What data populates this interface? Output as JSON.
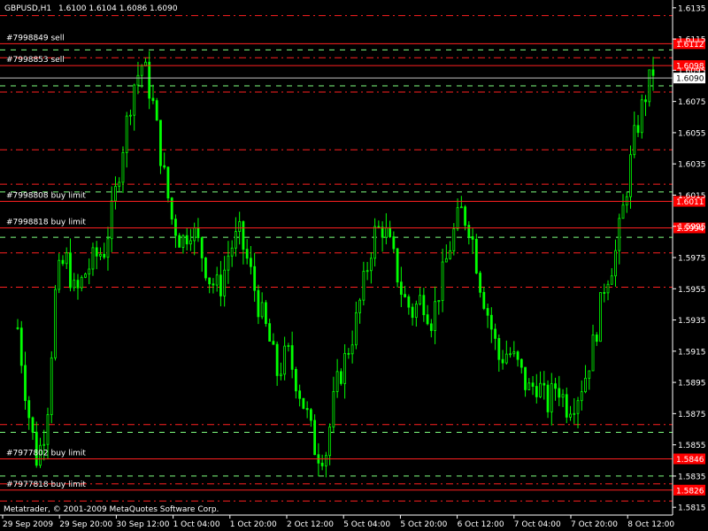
{
  "header": {
    "symbol": "GBPUSD,H1",
    "ohlc": "1.6100 1.6104 1.6086 1.6090"
  },
  "footer": {
    "copyright": "Metatrader, © 2001-2009 MetaQuotes Software Corp."
  },
  "colors": {
    "background": "#000000",
    "candle": "#00ff00",
    "order_line": "#ff2020",
    "level_line": "#ff2020",
    "buy_level_line": "#80ff80",
    "axis": "#ffffff",
    "current_price_tag_bg": "#ffffff",
    "order_tag_bg": "#ff0000"
  },
  "orders": [
    {
      "label": "#7998849 sell",
      "price": 1.6112,
      "tag": "1.6112"
    },
    {
      "label": "#7998853 sell",
      "price": 1.6098,
      "tag": "1.6098"
    },
    {
      "label": "#7998808 buy limit",
      "price": 1.6011,
      "tag": "1.6011"
    },
    {
      "label": "#7998818 buy limit",
      "price": 1.5994,
      "tag": "1.5994"
    },
    {
      "label": "#7977802 buy limit",
      "price": 1.5846,
      "tag": "1.5846"
    },
    {
      "label": "#7977818 buy limit",
      "price": 1.5826,
      "tag": "1.5826"
    }
  ],
  "current_price": {
    "price": 1.609,
    "tag": "1.6090"
  },
  "red_levels": [
    1.613,
    1.6103,
    1.6081,
    1.6044,
    1.6022,
    1.5978,
    1.5956,
    1.5868,
    1.583,
    1.5819
  ],
  "green_levels": [
    1.6108,
    1.6085,
    1.6017,
    1.5988,
    1.5863,
    1.5835
  ],
  "chart_data": {
    "type": "candlestick",
    "ylim": [
      1.581,
      1.614
    ],
    "y_ticks": [
      "1.6135",
      "1.6115",
      "1.6095",
      "1.6075",
      "1.6055",
      "1.6035",
      "1.6015",
      "1.5995",
      "1.5975",
      "1.5955",
      "1.5935",
      "1.5915",
      "1.5895",
      "1.5875",
      "1.5855",
      "1.5835",
      "1.5815"
    ],
    "x_ticks": [
      "29 Sep 2009",
      "29 Sep 20:00",
      "30 Sep 12:00",
      "1 Oct 04:00",
      "1 Oct 20:00",
      "2 Oct 12:00",
      "5 Oct 04:00",
      "5 Oct 20:00",
      "6 Oct 12:00",
      "7 Oct 04:00",
      "7 Oct 20:00",
      "8 Oct 12:00"
    ],
    "close_path": [
      1.593,
      1.588,
      1.5845,
      1.587,
      1.596,
      1.5975,
      1.595,
      1.5965,
      1.5975,
      1.598,
      1.601,
      1.605,
      1.6085,
      1.61,
      1.6075,
      1.6035,
      1.6,
      1.5985,
      1.5995,
      1.598,
      1.596,
      1.5955,
      1.598,
      1.599,
      1.597,
      1.5945,
      1.5925,
      1.59,
      1.5915,
      1.5895,
      1.5875,
      1.585,
      1.585,
      1.589,
      1.591,
      1.593,
      1.596,
      1.599,
      1.5995,
      1.5975,
      1.595,
      1.594,
      1.595,
      1.5935,
      1.596,
      1.5985,
      1.6005,
      1.5995,
      1.596,
      1.5935,
      1.591,
      1.5915,
      1.5905,
      1.589,
      1.5895,
      1.588,
      1.5895,
      1.588,
      1.5885,
      1.59,
      1.5925,
      1.596,
      1.5975,
      1.601,
      1.605,
      1.6075,
      1.6095
    ]
  }
}
